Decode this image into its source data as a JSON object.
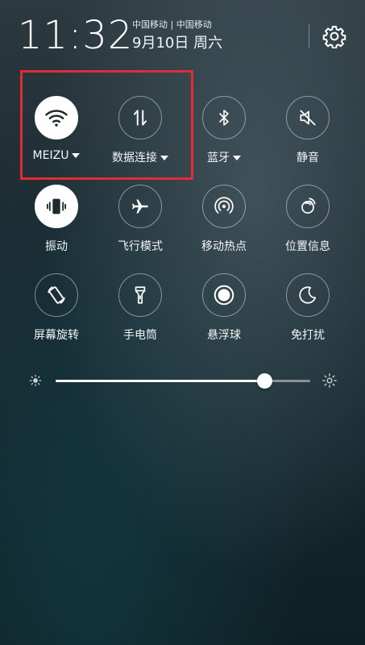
{
  "status": {
    "time": "11:32",
    "carrier": "中国移动 | 中国移动",
    "date": "9月10日 周六"
  },
  "tiles": [
    {
      "label": "MEIZU",
      "icon": "wifi-icon",
      "active": true,
      "dropdown": true
    },
    {
      "label": "数据连接",
      "icon": "mobile-data-icon",
      "active": false,
      "dropdown": true
    },
    {
      "label": "蓝牙",
      "icon": "bluetooth-icon",
      "active": false,
      "dropdown": true
    },
    {
      "label": "静音",
      "icon": "mute-icon",
      "active": false,
      "dropdown": false
    },
    {
      "label": "振动",
      "icon": "vibrate-icon",
      "active": true,
      "dropdown": false
    },
    {
      "label": "飞行模式",
      "icon": "airplane-icon",
      "active": false,
      "dropdown": false
    },
    {
      "label": "移动热点",
      "icon": "hotspot-icon",
      "active": false,
      "dropdown": false
    },
    {
      "label": "位置信息",
      "icon": "location-icon",
      "active": false,
      "dropdown": false
    },
    {
      "label": "屏幕旋转",
      "icon": "rotate-icon",
      "active": false,
      "dropdown": false
    },
    {
      "label": "手电筒",
      "icon": "flashlight-icon",
      "active": false,
      "dropdown": false
    },
    {
      "label": "悬浮球",
      "icon": "floating-ball-icon",
      "active": false,
      "dropdown": false
    },
    {
      "label": "免打扰",
      "icon": "do-not-disturb-icon",
      "active": false,
      "dropdown": false
    }
  ],
  "brightness": {
    "level": 0.82
  },
  "colors": {
    "highlight": "#e12b35",
    "active": "#ffffff"
  }
}
